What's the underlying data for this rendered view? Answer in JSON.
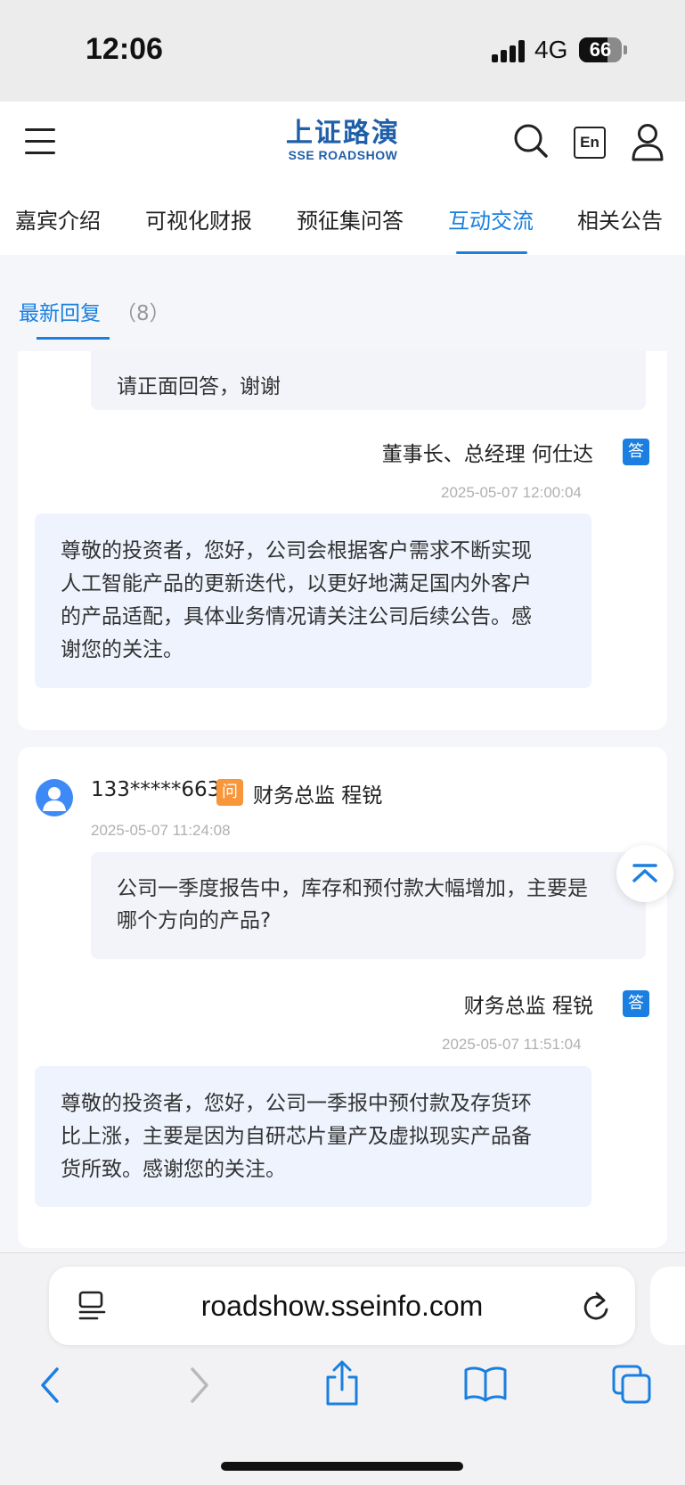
{
  "status_bar": {
    "time": "12:06",
    "network": "4G",
    "battery": "66",
    "battery_level": 0.66
  },
  "header": {
    "logo_main": "上证路演",
    "logo_sub": "SSE ROADSHOW",
    "lang_button": "En"
  },
  "tabs": [
    {
      "label": "嘉宾介绍"
    },
    {
      "label": "可视化财报"
    },
    {
      "label": "预征集问答"
    },
    {
      "label": "互动交流",
      "active": true
    },
    {
      "label": "相关公告"
    }
  ],
  "subtab": {
    "label": "最新回复",
    "count": "（8）"
  },
  "qa": [
    {
      "question_tail": "请正面回答，谢谢",
      "answerer": "董事长、总经理  何仕达",
      "answer_badge": "答",
      "answer_time": "2025-05-07 12:00:04",
      "answer_lines": [
        "尊敬的投资者，您好，公司会根据客户需求不断实现",
        "人工智能产品的更新迭代，以更好地满足国内外客户",
        "的产品适配，具体业务情况请关注公司后续公告。感",
        "谢您的关注。"
      ]
    },
    {
      "asker": "133*****663",
      "ask_badge": "问",
      "target": "财务总监  程锐",
      "ask_time": "2025-05-07 11:24:08",
      "question_lines": [
        "公司一季度报告中，库存和预付款大幅增加，主要是",
        "哪个方向的产品?"
      ],
      "answerer": "财务总监  程锐",
      "answer_badge": "答",
      "answer_time": "2025-05-07 11:51:04",
      "answer_lines": [
        "尊敬的投资者，您好，公司一季报中预付款及存货环",
        "比上涨，主要是因为自研芯片量产及虚拟现实产品备",
        "货所致。感谢您的关注。"
      ]
    }
  ],
  "browser": {
    "url": "roadshow.sseinfo.com"
  },
  "colors": {
    "accent": "#1a7fe0",
    "ask_badge": "#f7963b",
    "logo": "#1f5fa8"
  }
}
